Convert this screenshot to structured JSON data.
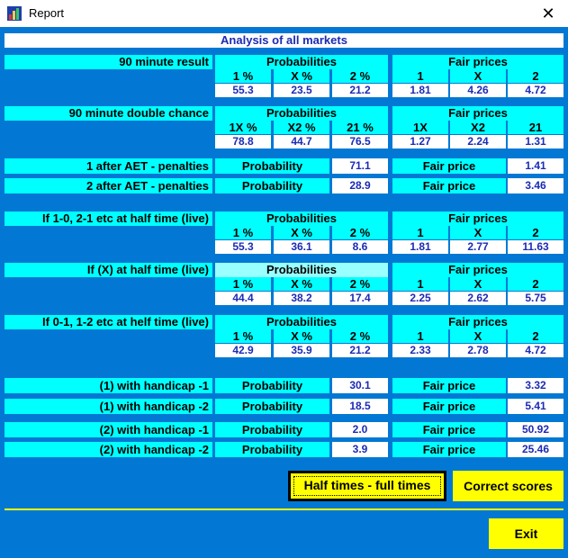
{
  "window": {
    "title": "Report",
    "close_glyph": "✕"
  },
  "banner": "Analysis of all markets",
  "rows": {
    "r90": {
      "label": "90 minute result",
      "head": "Probabilities",
      "cols": [
        "1 %",
        "X %",
        "2 %"
      ],
      "vals": [
        "55.3",
        "23.5",
        "21.2"
      ],
      "fair_head": "Fair prices",
      "fair_cols": [
        "1",
        "X",
        "2"
      ],
      "fair_vals": [
        "1.81",
        "4.26",
        "4.72"
      ]
    },
    "rdc": {
      "label": "90 minute double chance",
      "head": "Probabilities",
      "cols": [
        "1X %",
        "X2 %",
        "21 %"
      ],
      "vals": [
        "78.8",
        "44.7",
        "76.5"
      ],
      "fair_head": "Fair prices",
      "fair_cols": [
        "1X",
        "X2",
        "21"
      ],
      "fair_vals": [
        "1.27",
        "2.24",
        "1.31"
      ]
    },
    "aet1": {
      "label": "1 after AET - penalties",
      "prob_label": "Probability",
      "prob": "71.1",
      "fair_label": "Fair price",
      "fair": "1.41"
    },
    "aet2": {
      "label": "2 after AET - penalties",
      "prob_label": "Probability",
      "prob": "28.9",
      "fair_label": "Fair price",
      "fair": "3.46"
    },
    "ht1": {
      "label": "If 1-0, 2-1 etc at half time (live)",
      "head": "Probabilities",
      "cols": [
        "1 %",
        "X %",
        "2 %"
      ],
      "vals": [
        "55.3",
        "36.1",
        "8.6"
      ],
      "fair_head": "Fair prices",
      "fair_cols": [
        "1",
        "X",
        "2"
      ],
      "fair_vals": [
        "1.81",
        "2.77",
        "11.63"
      ]
    },
    "htx": {
      "label": "If (X) at half time (live)",
      "head": "Probabilities",
      "cols": [
        "1 %",
        "X %",
        "2 %"
      ],
      "vals": [
        "44.4",
        "38.2",
        "17.4"
      ],
      "fair_head": "Fair prices",
      "fair_cols": [
        "1",
        "X",
        "2"
      ],
      "fair_vals": [
        "2.25",
        "2.62",
        "5.75"
      ]
    },
    "ht2": {
      "label": "If 0-1, 1-2 etc at helf time (live)",
      "head": "Probabilities",
      "cols": [
        "1 %",
        "X %",
        "2 %"
      ],
      "vals": [
        "42.9",
        "35.9",
        "21.2"
      ],
      "fair_head": "Fair prices",
      "fair_cols": [
        "1",
        "X",
        "2"
      ],
      "fair_vals": [
        "2.33",
        "2.78",
        "4.72"
      ]
    },
    "h1m1": {
      "label": "(1) with handicap -1",
      "prob_label": "Probability",
      "prob": "30.1",
      "fair_label": "Fair price",
      "fair": "3.32"
    },
    "h1m2": {
      "label": "(1) with handicap -2",
      "prob_label": "Probability",
      "prob": "18.5",
      "fair_label": "Fair price",
      "fair": "5.41"
    },
    "h2m1": {
      "label": "(2) with handicap -1",
      "prob_label": "Probability",
      "prob": "2.0",
      "fair_label": "Fair price",
      "fair": "50.92"
    },
    "h2m2": {
      "label": "(2) with handicap -2",
      "prob_label": "Probability",
      "prob": "3.9",
      "fair_label": "Fair price",
      "fair": "25.46"
    }
  },
  "buttons": {
    "half_full": "Half times - full times",
    "correct": "Correct scores",
    "exit": "Exit"
  },
  "colors": {
    "background": "#0278d4",
    "label": "#00ffff",
    "value_text": "#1a2bb5",
    "button": "#ffff00"
  }
}
